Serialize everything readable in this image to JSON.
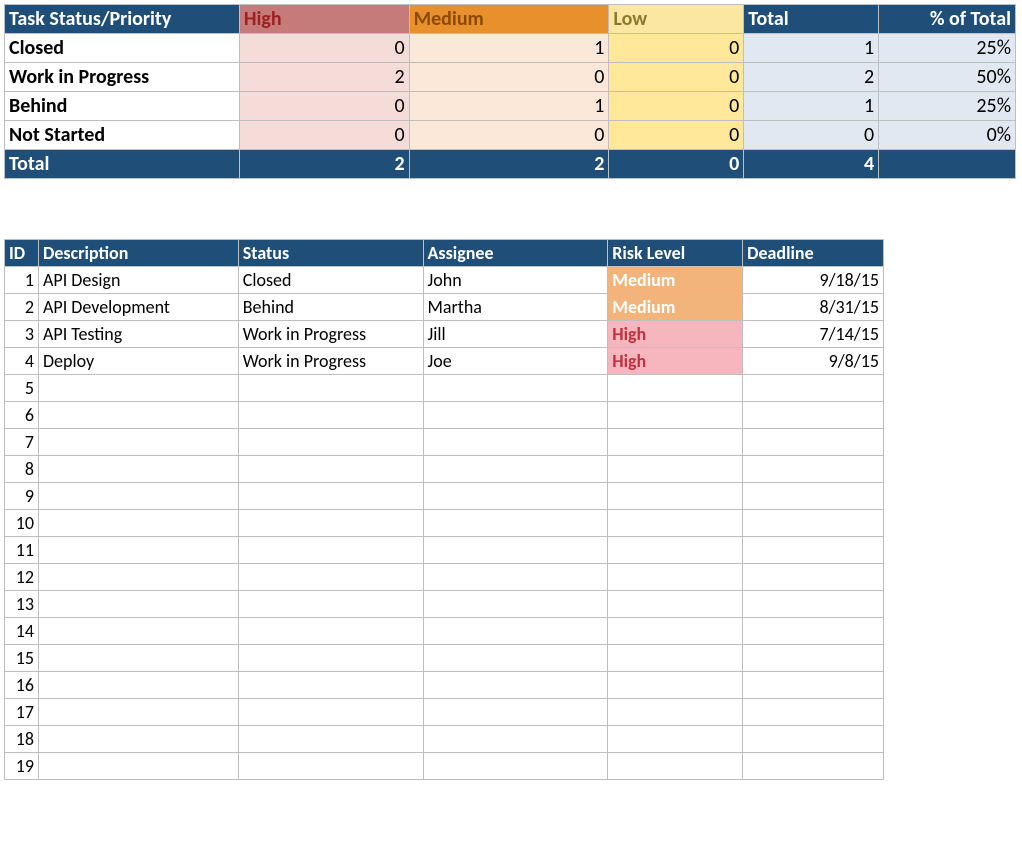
{
  "summary": {
    "header": {
      "title": "Task Status/Priority",
      "cols": [
        "High",
        "Medium",
        "Low",
        "Total",
        "% of Total"
      ]
    },
    "rows": [
      {
        "label": "Closed",
        "high": 0,
        "medium": 1,
        "low": 0,
        "total": 1,
        "pct": "25%"
      },
      {
        "label": "Work in Progress",
        "high": 2,
        "medium": 0,
        "low": 0,
        "total": 2,
        "pct": "50%"
      },
      {
        "label": "Behind",
        "high": 0,
        "medium": 1,
        "low": 0,
        "total": 1,
        "pct": "25%"
      },
      {
        "label": "Not Started",
        "high": 0,
        "medium": 0,
        "low": 0,
        "total": 0,
        "pct": "0%"
      }
    ],
    "totals": {
      "label": "Total",
      "high": 2,
      "medium": 2,
      "low": 0,
      "total": 4,
      "pct": ""
    }
  },
  "detail": {
    "headers": [
      "ID",
      "Description",
      "Status",
      "Assignee",
      "Risk Level",
      "Deadline"
    ],
    "rows": [
      {
        "id": 1,
        "description": "API Design",
        "status": "Closed",
        "assignee": "John",
        "risk": "Medium",
        "deadline": "9/18/15"
      },
      {
        "id": 2,
        "description": "API Development",
        "status": "Behind",
        "assignee": "Martha",
        "risk": "Medium",
        "deadline": "8/31/15"
      },
      {
        "id": 3,
        "description": "API Testing",
        "status": "Work in Progress",
        "assignee": "Jill",
        "risk": "High",
        "deadline": "7/14/15"
      },
      {
        "id": 4,
        "description": "Deploy",
        "status": "Work in Progress",
        "assignee": "Joe",
        "risk": "High",
        "deadline": "9/8/15"
      }
    ],
    "empty_rows": [
      5,
      6,
      7,
      8,
      9,
      10,
      11,
      12,
      13,
      14,
      15,
      16,
      17,
      18,
      19
    ]
  },
  "chart_data": {
    "type": "table",
    "title": "Task Status/Priority",
    "categories": [
      "Closed",
      "Work in Progress",
      "Behind",
      "Not Started"
    ],
    "series": [
      {
        "name": "High",
        "values": [
          0,
          2,
          0,
          0
        ]
      },
      {
        "name": "Medium",
        "values": [
          1,
          0,
          1,
          0
        ]
      },
      {
        "name": "Low",
        "values": [
          0,
          0,
          0,
          0
        ]
      },
      {
        "name": "Total",
        "values": [
          1,
          2,
          1,
          0
        ]
      },
      {
        "name": "% of Total",
        "values": [
          25,
          50,
          25,
          0
        ]
      }
    ],
    "totals": {
      "High": 2,
      "Medium": 2,
      "Low": 0,
      "Total": 4
    }
  }
}
